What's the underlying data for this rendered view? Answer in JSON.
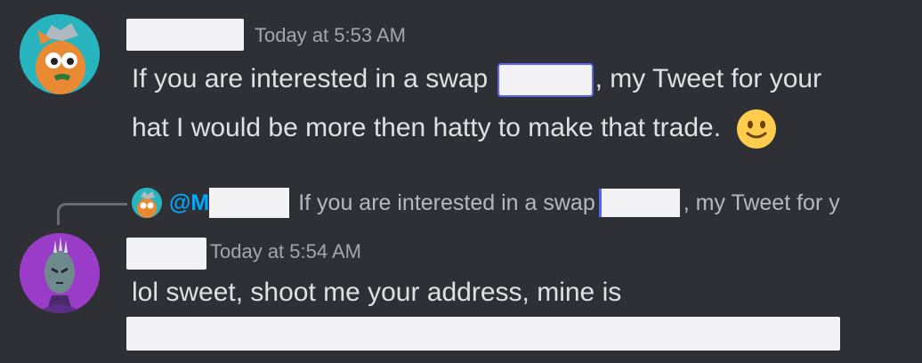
{
  "messages": [
    {
      "timestamp": "Today at 5:53 AM",
      "line1_before": "If you are interested in a swap",
      "line1_after": ", my Tweet for your",
      "line2": "hat I would be more then hatty to make that trade."
    },
    {
      "reply_to": {
        "mention_prefix": "@M",
        "text_before": "If you are interested in a swap",
        "text_after": ", my Tweet for y"
      },
      "timestamp": "Today at 5:54 AM",
      "line1": "lol sweet, shoot me your address, mine is"
    }
  ],
  "colors": {
    "background": "#2f3035",
    "mention": "#00a8fc",
    "timestamp": "#a3a6aa"
  }
}
